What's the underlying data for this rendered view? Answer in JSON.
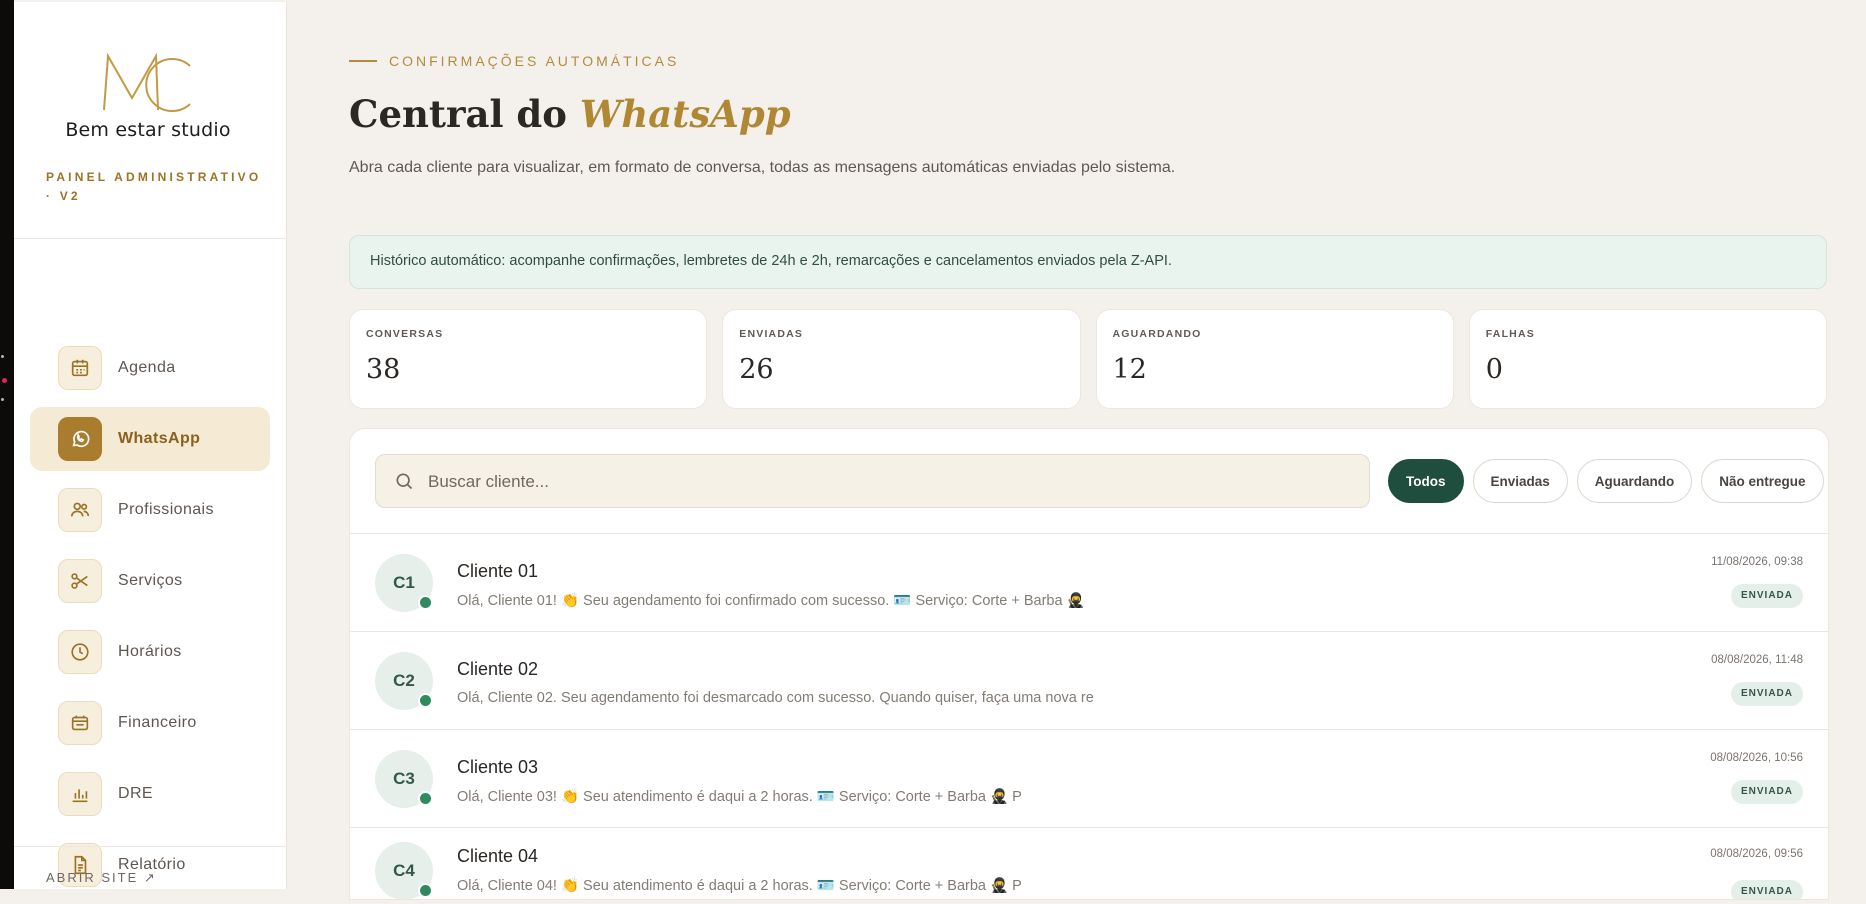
{
  "sidebar": {
    "brand_monogram": "MC",
    "brand_name": "Bem estar studio",
    "panel_label": "PAINEL ADMINISTRATIVO · V2",
    "items": [
      {
        "label": "Agenda",
        "icon": "calendar-icon"
      },
      {
        "label": "WhatsApp",
        "icon": "whatsapp-icon",
        "active": true
      },
      {
        "label": "Profissionais",
        "icon": "users-icon"
      },
      {
        "label": "Serviços",
        "icon": "scissors-icon"
      },
      {
        "label": "Horários",
        "icon": "clock-icon"
      },
      {
        "label": "Financeiro",
        "icon": "wallet-icon"
      },
      {
        "label": "DRE",
        "icon": "bar-chart-icon"
      },
      {
        "label": "Relatório",
        "icon": "document-icon"
      }
    ],
    "site_link": "ABRIR SITE ↗"
  },
  "header": {
    "eyebrow": "CONFIRMAÇÕES AUTOMÁTICAS",
    "title_plain": "Central do",
    "title_accent": "WhatsApp",
    "subtitle": "Abra cada cliente para visualizar, em formato de conversa, todas as mensagens automáticas enviadas pelo sistema."
  },
  "banner": "Histórico automático: acompanhe confirmações, lembretes de 24h e 2h, remarcações e cancelamentos enviados pela Z-API.",
  "stats": [
    {
      "label": "CONVERSAS",
      "value": "38"
    },
    {
      "label": "ENVIADAS",
      "value": "26"
    },
    {
      "label": "AGUARDANDO",
      "value": "12"
    },
    {
      "label": "FALHAS",
      "value": "0"
    }
  ],
  "search": {
    "placeholder": "Buscar cliente..."
  },
  "filters": [
    {
      "label": "Todos",
      "active": true
    },
    {
      "label": "Enviadas"
    },
    {
      "label": "Aguardando"
    },
    {
      "label": "Não entregue"
    }
  ],
  "conversations": [
    {
      "initials": "C1",
      "name": "Cliente 01",
      "preview": "Olá, Cliente 01! 👏 Seu agendamento foi confirmado com sucesso. 🪪 Serviço: Corte + Barba 🥷",
      "time": "11/08/2026, 09:38",
      "status": "ENVIADA"
    },
    {
      "initials": "C2",
      "name": "Cliente 02",
      "preview": "Olá, Cliente 02. Seu agendamento foi desmarcado com sucesso. Quando quiser, faça uma nova re",
      "time": "08/08/2026, 11:48",
      "status": "ENVIADA"
    },
    {
      "initials": "C3",
      "name": "Cliente 03",
      "preview": "Olá, Cliente 03! 👏 Seu atendimento é daqui a 2 horas. 🪪 Serviço: Corte + Barba 🥷 P",
      "time": "08/08/2026, 10:56",
      "status": "ENVIADA"
    },
    {
      "initials": "C4",
      "name": "Cliente 04",
      "preview": "Olá, Cliente 04! 👏 Seu atendimento é daqui a 2 horas. 🪪 Serviço: Corte + Barba 🥷 P",
      "time": "08/08/2026, 09:56",
      "status": "ENVIADA"
    }
  ],
  "colors": {
    "accent": "#b08834",
    "primary": "#1f4d3e",
    "online": "#2e8a5f"
  }
}
